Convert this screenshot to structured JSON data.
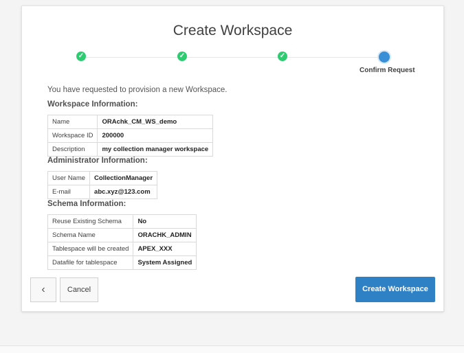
{
  "page_title": "Create Workspace",
  "wizard": {
    "steps": [
      {
        "status": "complete",
        "label": ""
      },
      {
        "status": "complete",
        "label": ""
      },
      {
        "status": "complete",
        "label": ""
      },
      {
        "status": "current",
        "label": "Confirm Request"
      }
    ],
    "check_glyph": "✓"
  },
  "intro_text": "You have requested to provision a new Workspace.",
  "workspace_info": {
    "heading": "Workspace Information:",
    "rows": [
      {
        "key": "Name",
        "value": "ORAchk_CM_WS_demo"
      },
      {
        "key": "Workspace ID",
        "value": "200000"
      },
      {
        "key": "Description",
        "value": "my collection manager workspace"
      }
    ]
  },
  "admin_info": {
    "heading": "Administrator Information:",
    "rows": [
      {
        "key": "User Name",
        "value": "CollectionManager"
      },
      {
        "key": "E-mail",
        "value": "abc.xyz@123.com"
      }
    ]
  },
  "schema_info": {
    "heading": "Schema Information:",
    "rows": [
      {
        "key": "Reuse Existing Schema",
        "value": "No"
      },
      {
        "key": "Schema Name",
        "value": "ORACHK_ADMIN"
      },
      {
        "key": "Tablespace will be created",
        "value": "APEX_XXX"
      },
      {
        "key": "Datafile for tablespace",
        "value": "System Assigned"
      }
    ]
  },
  "buttons": {
    "previous_glyph": "‹",
    "cancel": "Cancel",
    "create": "Create Workspace"
  },
  "colors": {
    "step_complete": "#2ecc71",
    "step_current": "#3a8fd6",
    "primary_button": "#2f81c6"
  }
}
